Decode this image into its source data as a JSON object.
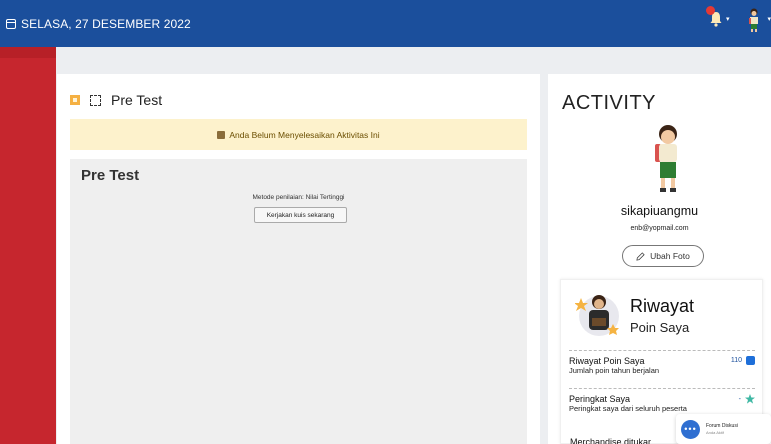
{
  "topbar": {
    "date": "SELASA, 27 DESEMBER 2022",
    "caret": "▾",
    "icons": {
      "calendar": "calendar-icon",
      "bell": "bell-icon",
      "avatar": "user-avatar"
    },
    "colors": {
      "bar": "#1b4f9c",
      "notification": "#e53935"
    }
  },
  "sidebar": {
    "color": "#c6262e"
  },
  "main": {
    "title": "Pre Test",
    "alert": "Anda Belum Menyelesaikan Aktivitas Ini",
    "alert_color": "#fdf2cc",
    "quiz": {
      "heading": "Pre Test",
      "method": "Metode penilaian: Nilai Tertinggi",
      "button": "Kerjakan kuis sekarang"
    }
  },
  "activity": {
    "title": "ACTIVITY",
    "username": "sikapiuangmu",
    "email": "enb@yopmail.com",
    "change_photo": "Ubah Foto",
    "riwayat": {
      "title": "Riwayat",
      "subtitle": "Poin Saya",
      "items": [
        {
          "label": "Riwayat Poin Saya",
          "sub": "Jumlah poin tahun berjalan",
          "value": "110"
        },
        {
          "label": "Peringkat Saya",
          "sub": "Peringkat saya dari seluruh peserta",
          "value": "-"
        }
      ],
      "peek": "Merchandise ditukar"
    }
  },
  "forum": {
    "title": "Forum Diskusi",
    "status": "Anda Aktif",
    "dots": "•••"
  }
}
